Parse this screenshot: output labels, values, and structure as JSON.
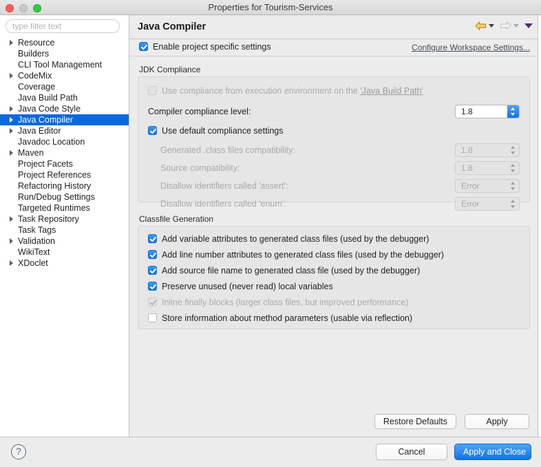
{
  "window": {
    "title": "Properties for Tourism-Services",
    "traffic_lights": [
      "close",
      "minimize",
      "zoom"
    ]
  },
  "sidebar": {
    "filter": {
      "placeholder": "type filter text",
      "value": ""
    },
    "items": [
      {
        "label": "Resource",
        "expandable": true,
        "selected": false
      },
      {
        "label": "Builders",
        "expandable": false,
        "selected": false
      },
      {
        "label": "CLI Tool Management",
        "expandable": false,
        "selected": false
      },
      {
        "label": "CodeMix",
        "expandable": true,
        "selected": false
      },
      {
        "label": "Coverage",
        "expandable": false,
        "selected": false
      },
      {
        "label": "Java Build Path",
        "expandable": false,
        "selected": false
      },
      {
        "label": "Java Code Style",
        "expandable": true,
        "selected": false
      },
      {
        "label": "Java Compiler",
        "expandable": true,
        "selected": true
      },
      {
        "label": "Java Editor",
        "expandable": true,
        "selected": false
      },
      {
        "label": "Javadoc Location",
        "expandable": false,
        "selected": false
      },
      {
        "label": "Maven",
        "expandable": true,
        "selected": false
      },
      {
        "label": "Project Facets",
        "expandable": false,
        "selected": false
      },
      {
        "label": "Project References",
        "expandable": false,
        "selected": false
      },
      {
        "label": "Refactoring History",
        "expandable": false,
        "selected": false
      },
      {
        "label": "Run/Debug Settings",
        "expandable": false,
        "selected": false
      },
      {
        "label": "Targeted Runtimes",
        "expandable": false,
        "selected": false
      },
      {
        "label": "Task Repository",
        "expandable": true,
        "selected": false
      },
      {
        "label": "Task Tags",
        "expandable": false,
        "selected": false
      },
      {
        "label": "Validation",
        "expandable": true,
        "selected": false
      },
      {
        "label": "WikiText",
        "expandable": false,
        "selected": false
      },
      {
        "label": "XDoclet",
        "expandable": true,
        "selected": false
      }
    ]
  },
  "page": {
    "title": "Java Compiler",
    "nav": {
      "back_icon": "back-arrow-icon",
      "forward_icon": "forward-arrow-icon",
      "menu_icon": "dropdown-caret-icon"
    },
    "enable_project_specific": {
      "label": "Enable project specific settings",
      "checked": true
    },
    "configure_workspace_link": "Configure Workspace Settings...",
    "jdk_compliance": {
      "title": "JDK Compliance",
      "use_execution_environment": {
        "label_prefix": "Use compliance from execution environment on the ",
        "link": "'Java Build Path'",
        "checked": false,
        "enabled": false
      },
      "compiler_compliance_level": {
        "label": "Compiler compliance level:",
        "value": "1.8",
        "enabled": true
      },
      "use_default_compliance": {
        "label": "Use default compliance settings",
        "checked": true,
        "enabled": true
      },
      "rows": [
        {
          "label": "Generated .class files compatibility:",
          "value": "1.8",
          "enabled": false
        },
        {
          "label": "Source compatibility:",
          "value": "1.8",
          "enabled": false
        },
        {
          "label": "Disallow identifiers called 'assert':",
          "value": "Error",
          "enabled": false
        },
        {
          "label": "Disallow identifiers called 'enum':",
          "value": "Error",
          "enabled": false
        }
      ]
    },
    "classfile_generation": {
      "title": "Classfile Generation",
      "options": [
        {
          "label": "Add variable attributes to generated class files (used by the debugger)",
          "checked": true,
          "enabled": true
        },
        {
          "label": "Add line number attributes to generated class files (used by the debugger)",
          "checked": true,
          "enabled": true
        },
        {
          "label": "Add source file name to generated class file (used by the debugger)",
          "checked": true,
          "enabled": true
        },
        {
          "label": "Preserve unused (never read) local variables",
          "checked": true,
          "enabled": true
        },
        {
          "label": "Inline finally blocks (larger class files, but improved performance)",
          "checked": true,
          "enabled": false
        },
        {
          "label": "Store information about method parameters (usable via reflection)",
          "checked": false,
          "enabled": true
        }
      ]
    },
    "content_buttons": {
      "restore_defaults": "Restore Defaults",
      "apply": "Apply"
    }
  },
  "footer": {
    "help_label": "?",
    "cancel": "Cancel",
    "apply_and_close": "Apply and Close"
  },
  "colors": {
    "selection_blue": "#0a69dc",
    "accent_blue": "#1272e6",
    "window_bg": "#ececec",
    "group_bg": "#e6e6e6"
  }
}
